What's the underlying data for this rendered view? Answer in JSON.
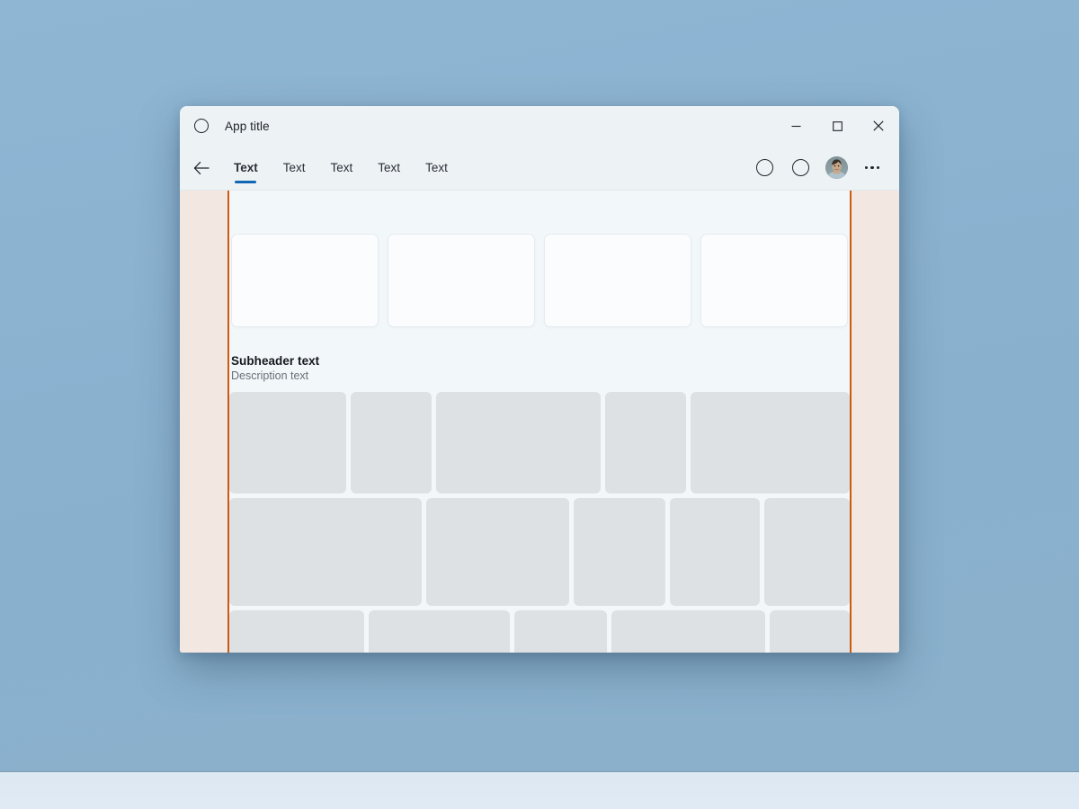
{
  "desktop": {
    "background_color": "#8CB4D2",
    "taskbar_color": "#DFE9F3"
  },
  "window": {
    "title": "App title",
    "app_icon": "circle-outline-icon",
    "caption": {
      "minimize_label": "Minimize",
      "minimize_icon": "minimize-icon",
      "maximize_label": "Maximize",
      "maximize_icon": "maximize-icon",
      "close_label": "Close",
      "close_icon": "close-icon"
    }
  },
  "toolbar": {
    "back_label": "Back",
    "back_icon": "arrow-left-icon",
    "tabs": [
      {
        "label": "Text",
        "active": true
      },
      {
        "label": "Text",
        "active": false
      },
      {
        "label": "Text",
        "active": false
      },
      {
        "label": "Text",
        "active": false
      },
      {
        "label": "Text",
        "active": false
      }
    ],
    "actions": [
      {
        "name": "toolbar-action-1",
        "icon": "circle-outline-icon"
      },
      {
        "name": "toolbar-action-2",
        "icon": "circle-outline-icon"
      }
    ],
    "avatar_icon": "user-avatar-photo",
    "overflow_label": "See more",
    "overflow_icon": "more-horizontal-icon",
    "active_tab_accent": "#1267B4"
  },
  "content": {
    "rails": {
      "fill_color": "#F2E7E1",
      "border_color": "#CC5A11"
    },
    "cards": [
      {
        "name": "content-card-1"
      },
      {
        "name": "content-card-2"
      },
      {
        "name": "content-card-3"
      },
      {
        "name": "content-card-4"
      }
    ],
    "section": {
      "subheader": "Subheader text",
      "description": "Description text"
    },
    "tile_color": "#DEE1E3",
    "tile_rows": [
      {
        "name": "tile-row-1",
        "widths": [
          133,
          92,
          187,
          92,
          181
        ]
      },
      {
        "name": "tile-row-2",
        "widths": [
          216,
          160,
          103,
          100,
          96
        ]
      },
      {
        "name": "tile-row-3",
        "widths": [
          154,
          160,
          106,
          175,
          91
        ]
      }
    ]
  }
}
